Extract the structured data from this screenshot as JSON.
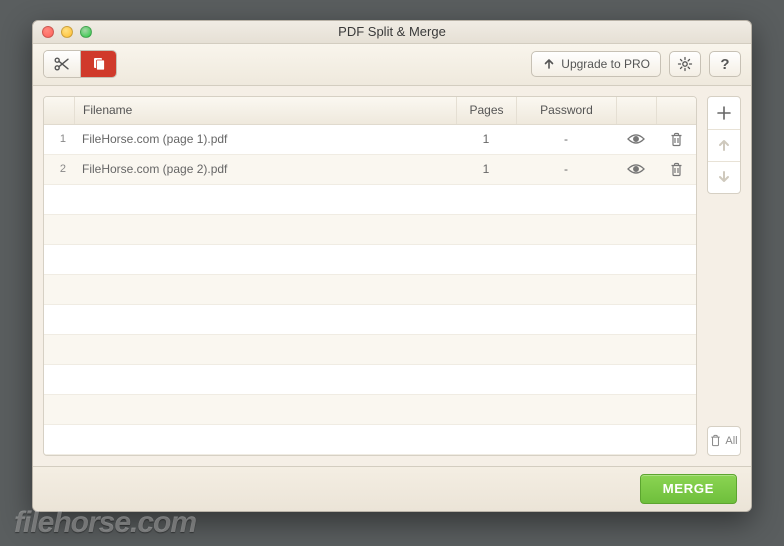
{
  "window": {
    "title": "PDF Split & Merge"
  },
  "toolbar": {
    "upgrade_label": "Upgrade to PRO"
  },
  "table": {
    "headers": {
      "filename": "Filename",
      "pages": "Pages",
      "password": "Password"
    },
    "rows": [
      {
        "idx": "1",
        "name": "FileHorse.com (page 1).pdf",
        "pages": "1",
        "password": "-"
      },
      {
        "idx": "2",
        "name": "FileHorse.com (page 2).pdf",
        "pages": "1",
        "password": "-"
      }
    ]
  },
  "sidebar": {
    "all_label": "All"
  },
  "footer": {
    "merge_label": "MERGE"
  },
  "watermark": "filehorse.com"
}
